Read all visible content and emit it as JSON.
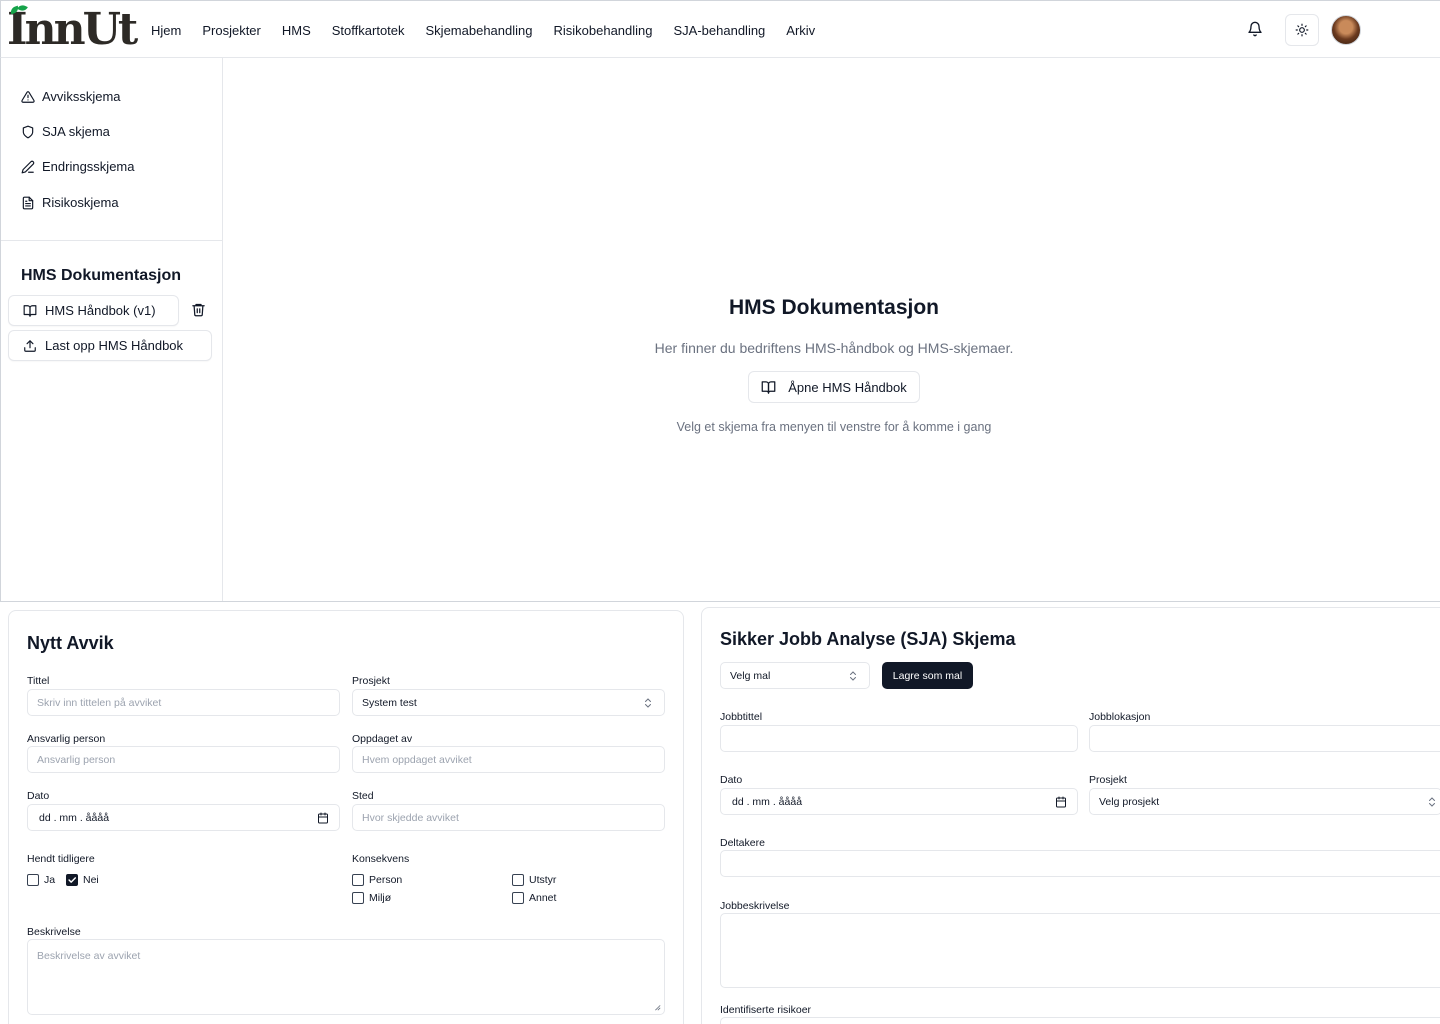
{
  "brand": {
    "logo_text": "InnUt",
    "leaf_color": "#16a34a"
  },
  "nav": {
    "items": [
      {
        "label": "Hjem"
      },
      {
        "label": "Prosjekter"
      },
      {
        "label": "HMS"
      },
      {
        "label": "Stoffkartotek"
      },
      {
        "label": "Skjemabehandling"
      },
      {
        "label": "Risikobehandling"
      },
      {
        "label": "SJA-behandling"
      },
      {
        "label": "Arkiv"
      }
    ]
  },
  "sidebar": {
    "forms": [
      {
        "label": "Avviksskjema",
        "icon": "warning-triangle-icon"
      },
      {
        "label": "SJA skjema",
        "icon": "shield-icon"
      },
      {
        "label": "Endringsskjema",
        "icon": "pencil-icon"
      },
      {
        "label": "Risikoskjema",
        "icon": "document-icon"
      }
    ],
    "docs_heading": "HMS Dokumentasjon",
    "handbook_label": "HMS Håndbok (v1)",
    "upload_label": "Last opp HMS Håndbok"
  },
  "main": {
    "title": "HMS Dokumentasjon",
    "subtitle": "Her finner du bedriftens HMS-håndbok og HMS-skjemaer.",
    "open_button": "Åpne HMS Håndbok",
    "hint": "Velg et skjema fra menyen til venstre for å komme i gang"
  },
  "avvik": {
    "title": "Nytt Avvik",
    "tittel_label": "Tittel",
    "tittel_placeholder": "Skriv inn tittelen på avviket",
    "prosjekt_label": "Prosjekt",
    "prosjekt_value": "System test",
    "ansvarlig_label": "Ansvarlig person",
    "ansvarlig_placeholder": "Ansvarlig person",
    "oppdaget_label": "Oppdaget av",
    "oppdaget_placeholder": "Hvem oppdaget avviket",
    "dato_label": "Dato",
    "dato_value": "dd . mm . åååå",
    "sted_label": "Sted",
    "sted_placeholder": "Hvor skjedde avviket",
    "hendt_label": "Hendt tidligere",
    "ja_label": "Ja",
    "nei_label": "Nei",
    "nei_checked": true,
    "konsekvens_label": "Konsekvens",
    "person_label": "Person",
    "utstyr_label": "Utstyr",
    "miljo_label": "Miljø",
    "annet_label": "Annet",
    "beskrivelse_label": "Beskrivelse",
    "beskrivelse_placeholder": "Beskrivelse av avviket"
  },
  "sja": {
    "title": "Sikker Jobb Analyse (SJA) Skjema",
    "mal_value": "Velg mal",
    "save_template": "Lagre som mal",
    "jobbtittel_label": "Jobbtittel",
    "jobblokasjon_label": "Jobblokasjon",
    "dato_label": "Dato",
    "dato_value": "dd . mm . åååå",
    "prosjekt_label": "Prosjekt",
    "prosjekt_value": "Velg prosjekt",
    "deltakere_label": "Deltakere",
    "jobbeskrivelse_label": "Jobbeskrivelse",
    "risikoer_label": "Identifiserte risikoer"
  }
}
